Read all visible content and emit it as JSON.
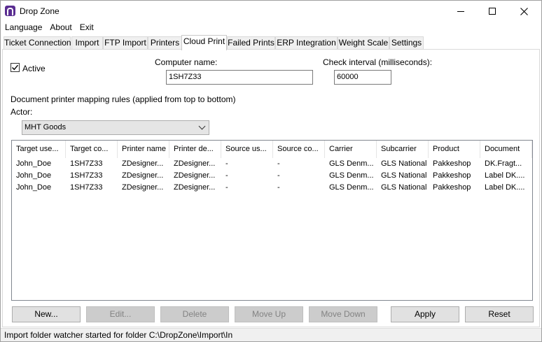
{
  "window": {
    "title": "Drop Zone",
    "minimize_icon": "minimize-icon",
    "maximize_icon": "maximize-icon",
    "close_icon": "close-icon",
    "app_icon": "dropzone-logo-icon",
    "app_icon_color": "#5a2d91"
  },
  "menu": [
    "Language",
    "About",
    "Exit"
  ],
  "tabs": [
    {
      "label": "Ticket Connection",
      "active": false
    },
    {
      "label": "Import",
      "active": false
    },
    {
      "label": "FTP Import",
      "active": false
    },
    {
      "label": "Printers",
      "active": false
    },
    {
      "label": "Cloud Print",
      "active": true
    },
    {
      "label": "Failed Prints",
      "active": false
    },
    {
      "label": "ERP Integration",
      "active": false
    },
    {
      "label": "Weight Scale",
      "active": false
    },
    {
      "label": "Settings",
      "active": false
    }
  ],
  "cloud_print": {
    "active_label": "Active",
    "active_checked": true,
    "computer_name_label": "Computer name:",
    "computer_name_value": "1SH7Z33",
    "check_interval_label": "Check interval (milliseconds):",
    "check_interval_value": "60000",
    "rules_label": "Document printer mapping rules (applied from top to bottom)",
    "actor_label": "Actor:",
    "actor_value": "MHT Goods"
  },
  "table": {
    "columns": [
      "Target use...",
      "Target co...",
      "Printer name",
      "Printer de...",
      "Source us...",
      "Source co...",
      "Carrier",
      "Subcarrier",
      "Product",
      "Document"
    ],
    "rows": [
      [
        "John_Doe",
        "1SH7Z33",
        "ZDesigner...",
        "ZDesigner...",
        "-",
        "-",
        "GLS Denm...",
        "GLS National",
        "Pakkeshop",
        "DK.Fragt..."
      ],
      [
        "John_Doe",
        "1SH7Z33",
        "ZDesigner...",
        "ZDesigner...",
        "-",
        "-",
        "GLS Denm...",
        "GLS National",
        "Pakkeshop",
        "Label DK...."
      ],
      [
        "John_Doe",
        "1SH7Z33",
        "ZDesigner...",
        "ZDesigner...",
        "-",
        "-",
        "GLS Denm...",
        "GLS National",
        "Pakkeshop",
        "Label DK...."
      ]
    ]
  },
  "buttons": {
    "new": "New...",
    "edit": "Edit...",
    "delete": "Delete",
    "move_up": "Move Up",
    "move_down": "Move Down",
    "apply": "Apply",
    "reset": "Reset"
  },
  "status": "Import folder watcher started for folder C:\\DropZone\\Import\\In"
}
